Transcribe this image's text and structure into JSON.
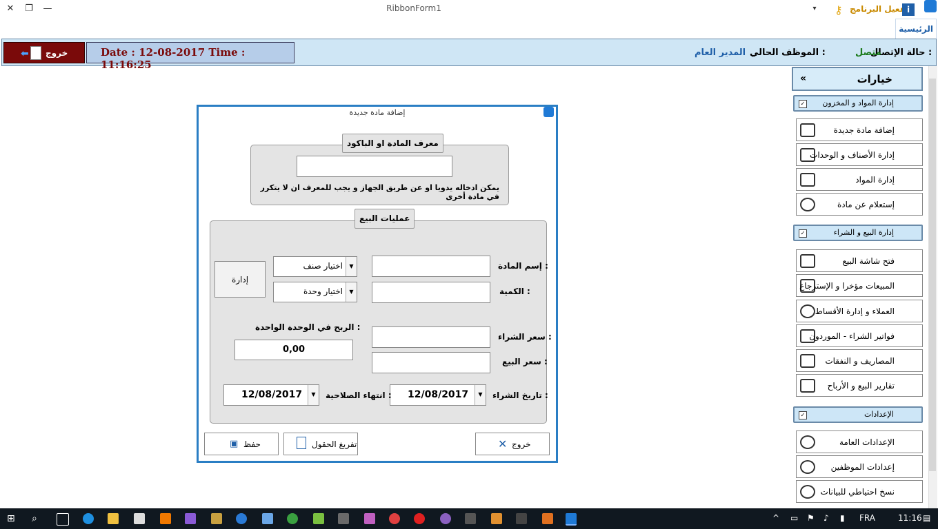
{
  "window": {
    "title": "RibbonForm1",
    "activate_label": "تفعيل البرنامج",
    "home_tab": "الرئيسية"
  },
  "status": {
    "exit_label": "خروج",
    "datetime": "Date : 12-08-2017  Time : 11:16:25",
    "connection_label": "حالة الإتصال :",
    "connection_value": "متصل",
    "employee_label": "الموظف الحالي :",
    "employee_value": "المدير العام"
  },
  "options": {
    "title": "خيارات",
    "collapse": "«",
    "groups": [
      {
        "label": "إدارة المواد و المخزون",
        "items": [
          "إضافة مادة جديدة",
          "إدارة الأصناف و الوحدات",
          "إدارة المواد",
          "إستعلام عن مادة"
        ]
      },
      {
        "label": "إدارة البيع و الشراء",
        "items": [
          "فتح شاشة البيع",
          "المبيعات مؤخرا و الإسترجاع",
          "العملاء و إدارة الأقساط",
          "فواتير الشراء - الموردون",
          "المصاريف و النفقات",
          "تقارير البيع و الأرباح"
        ]
      },
      {
        "label": "الإعدادات",
        "items": [
          "الإعدادات العامة",
          "إعدادات الموظفين",
          "نسخ احتياطي للبيانات"
        ]
      }
    ]
  },
  "dialog": {
    "title": "إضافة مادة جديدة",
    "barcode_group": "معرف المادة او الباكود",
    "barcode_value": "",
    "barcode_hint": "يمكن ادخاله يدويا او عن طريق الجهاز و يجب للمعرف ان لا يتكرر في مادة أخرى",
    "sales_group": "عمليات البيع",
    "name_label": "إسم المادة :",
    "qty_label": "الكمية :",
    "category_select": "اختيار صنف",
    "unit_select": "اختيار وحدة",
    "manage_button": "إدارة",
    "profit_label": "الربح في الوحدة الواحدة :",
    "profit_value": "0,00",
    "buy_price_label": "سعر الشراء :",
    "sell_price_label": "سعر البيع :",
    "buy_date_label": "تاريخ الشراء :",
    "buy_date": "12/08/2017",
    "expiry_label": "انتهاء الصلاحية :",
    "expiry_date": "12/08/2017",
    "save_button": "حفظ",
    "clear_button": "تفريغ الحقول",
    "exit_button": "خروج"
  },
  "taskbar": {
    "language": "FRA",
    "time": "11:16"
  }
}
